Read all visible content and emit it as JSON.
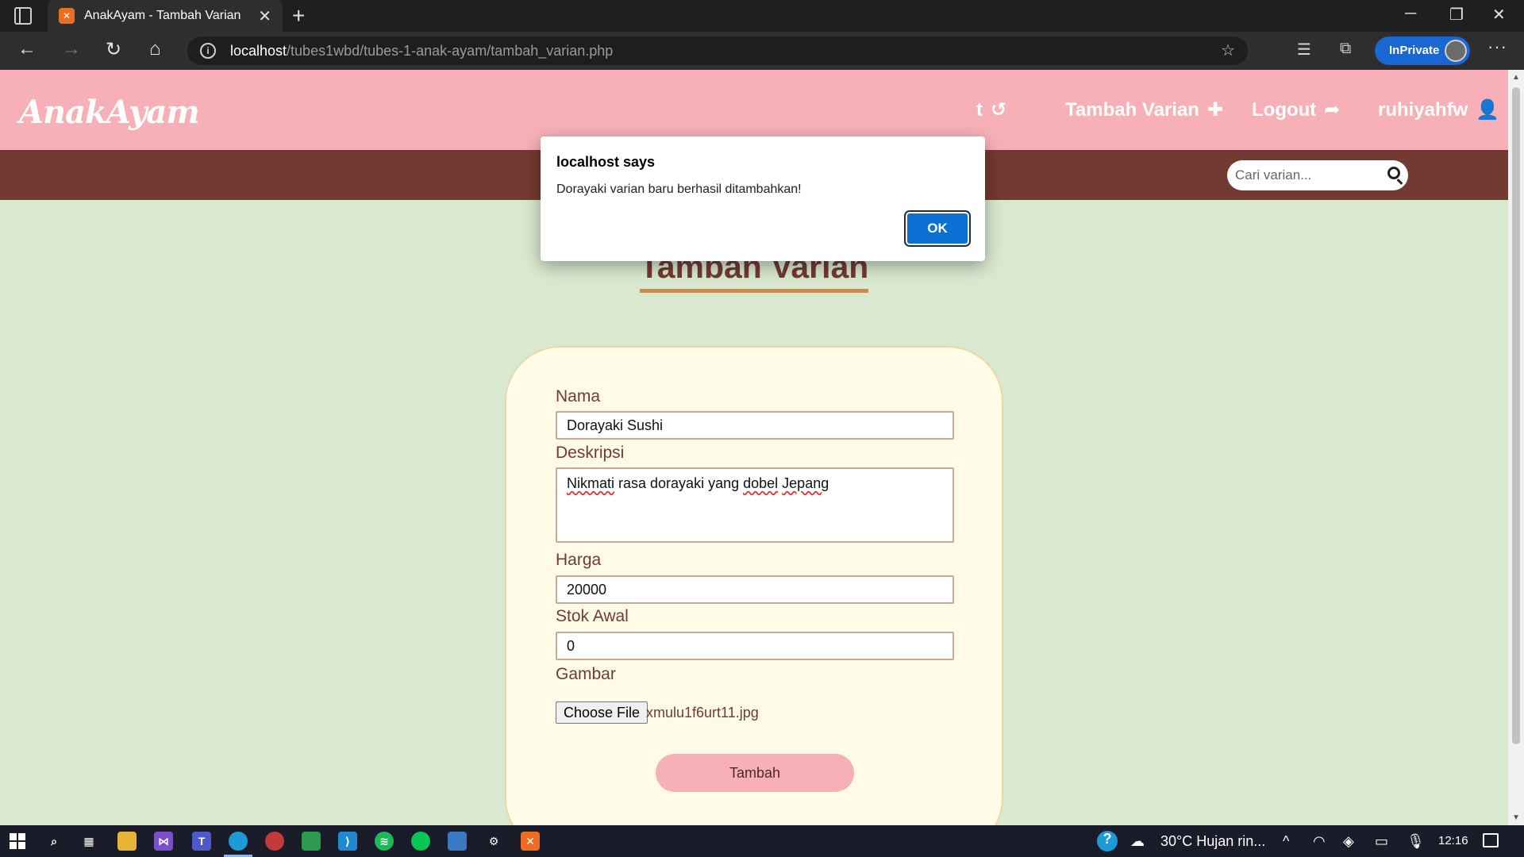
{
  "browser": {
    "tab_title": "AnakAyam - Tambah Varian",
    "tab_favicon": "xampp-icon",
    "url_host": "localhost",
    "url_path": "/tubes1wbd/tubes-1-anak-ayam/tambah_varian.php",
    "inprivate_label": "InPrivate",
    "more_label": "···"
  },
  "site": {
    "logo": "AnakAyam",
    "nav": {
      "history_label": "t",
      "add_variant_label": "Tambah Varian",
      "logout_label": "Logout",
      "user_label": "ruhiyahfw"
    },
    "search_placeholder": "Cari varian...",
    "colors": {
      "header": "#f7b0b8",
      "subbar": "#733a31",
      "page_bg": "#d9e9cf",
      "card_bg": "#fffbe6",
      "title_underline": "#c48c52"
    }
  },
  "form": {
    "title": "Tambah Varian",
    "name_label": "Nama",
    "name_value": "Dorayaki Sushi",
    "description_label": "Deskripsi",
    "description_word1": "Nikmati",
    "description_mid": " rasa dorayaki yang ",
    "description_word2": "dobel",
    "description_word3": "Jepang",
    "price_label": "Harga",
    "price_value": "20000",
    "stock_label": "Stok Awal",
    "stock_value": "0",
    "image_label": "Gambar",
    "file_button": "Choose File",
    "file_name": "xmulu1f6urt11.jpg",
    "submit_label": "Tambah"
  },
  "dialog": {
    "title": "localhost says",
    "message": "Dorayaki varian baru berhasil ditambahkan!",
    "ok_label": "OK"
  },
  "taskbar": {
    "weather": "30°C  Hujan rin...",
    "time": "12:16"
  }
}
